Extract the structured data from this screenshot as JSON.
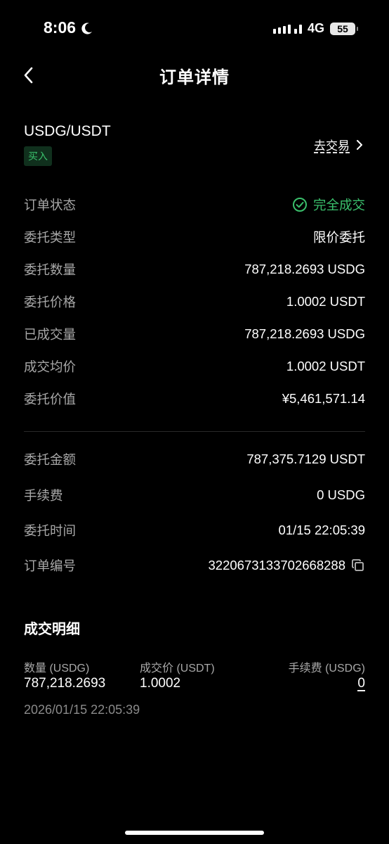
{
  "status_bar": {
    "time": "8:06",
    "network": "4G",
    "battery": "55"
  },
  "header": {
    "title": "订单详情"
  },
  "pair": {
    "name": "USDG/USDT",
    "side": "买入",
    "trade_link": "去交易"
  },
  "details": [
    {
      "label": "订单状态",
      "value": "完全成交"
    },
    {
      "label": "委托类型",
      "value": "限价委托"
    },
    {
      "label": "委托数量",
      "value": "787,218.2693 USDG"
    },
    {
      "label": "委托价格",
      "value": "1.0002 USDT"
    },
    {
      "label": "已成交量",
      "value": "787,218.2693 USDG"
    },
    {
      "label": "成交均价",
      "value": "1.0002 USDT"
    },
    {
      "label": "委托价值",
      "value": "¥5,461,571.14"
    }
  ],
  "details2": [
    {
      "label": "委托金额",
      "value": "787,375.7129 USDT"
    },
    {
      "label": "手续费",
      "value": "0 USDG"
    },
    {
      "label": "委托时间",
      "value": "01/15 22:05:39"
    },
    {
      "label": "订单编号",
      "value": "3220673133702668288"
    }
  ],
  "fills": {
    "title": "成交明细",
    "headers": [
      "数量 (USDG)",
      "成交价 (USDT)",
      "手续费 (USDG)"
    ],
    "rows": [
      {
        "qty": "787,218.2693",
        "price": "1.0002",
        "fee": "0",
        "time": "2026/01/15 22:05:39"
      }
    ]
  },
  "colors": {
    "background": "#000000",
    "accent_green": "#3ac06c",
    "label_gray": "#a8a8a8"
  }
}
